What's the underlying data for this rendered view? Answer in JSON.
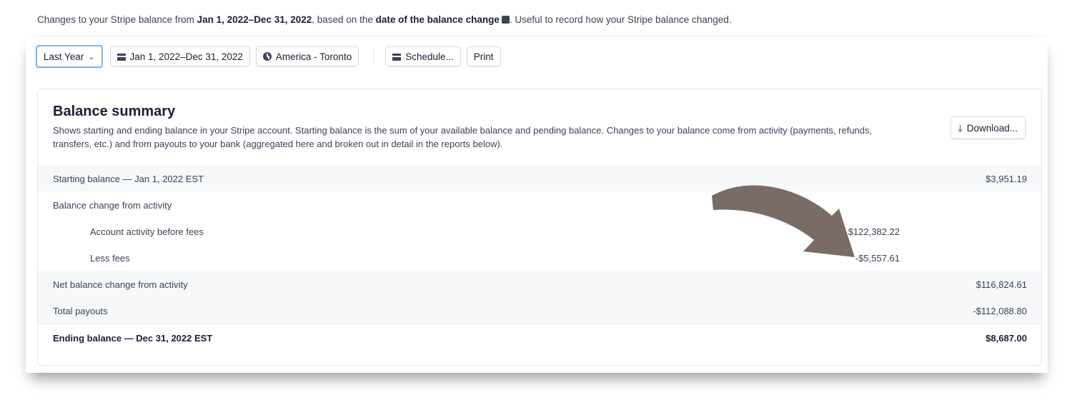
{
  "intro": {
    "prefix": "Changes to your Stripe balance from ",
    "date_range": "Jan 1, 2022–Dec 31, 2022",
    "middle": ", based on the ",
    "basis": "date of the balance change",
    "suffix": ". Useful to record how your Stripe balance changed."
  },
  "toolbar": {
    "period_select": "Last Year",
    "date_range": "Jan 1, 2022–Dec 31, 2022",
    "timezone": "America - Toronto",
    "schedule_label": "Schedule...",
    "print_label": "Print"
  },
  "summary": {
    "title": "Balance summary",
    "description": "Shows starting and ending balance in your Stripe account. Starting balance is the sum of your available balance and pending balance. Changes to your balance come from activity (payments, refunds, transfers, etc.) and from payouts to your bank (aggregated here and broken out in detail in the reports below).",
    "download_label": "Download...",
    "rows": [
      {
        "label": "Starting balance — Jan 1, 2022 EST",
        "amount": "$3,951.19",
        "sub_amount": ""
      },
      {
        "label": "Balance change from activity",
        "amount": "",
        "sub_amount": ""
      },
      {
        "label": "Account activity before fees",
        "amount": "",
        "sub_amount": "$122,382.22"
      },
      {
        "label": "Less fees",
        "amount": "",
        "sub_amount": "-$5,557.61"
      },
      {
        "label": "Net balance change from activity",
        "amount": "$116,824.61",
        "sub_amount": ""
      },
      {
        "label": "Total payouts",
        "amount": "-$112,088.80",
        "sub_amount": ""
      },
      {
        "label": "Ending balance — Dec 31, 2022 EST",
        "amount": "$8,687.00",
        "sub_amount": ""
      }
    ]
  },
  "colors": {
    "arrow": "#7a6b67",
    "text": "#3c4257",
    "heading": "#1a1f36",
    "row_shade": "#f6f8fa",
    "border": "#e3e8ee",
    "focus_ring": "#7fb6e6"
  },
  "icons": [
    "chevron-down-icon",
    "calendar-icon",
    "clock-icon",
    "download-icon",
    "info-icon",
    "arrow-annotation"
  ]
}
